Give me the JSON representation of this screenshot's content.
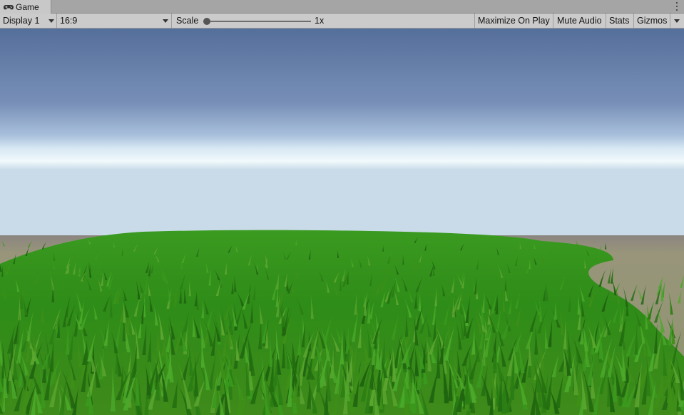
{
  "tab": {
    "title": "Game",
    "icon": "gamepad-icon"
  },
  "toolbar": {
    "display": "Display 1",
    "aspect": "16:9",
    "scale_label": "Scale",
    "scale_value": "1x",
    "scale_slider_level": 0.05,
    "maximize": "Maximize On Play",
    "mute": "Mute Audio",
    "stats": "Stats",
    "gizmos": "Gizmos"
  },
  "colors": {
    "sky_top": "#556f9b",
    "horizon": "#e8f4fa",
    "grass": "#2f8f1c",
    "ground": "#8c8f6c"
  }
}
